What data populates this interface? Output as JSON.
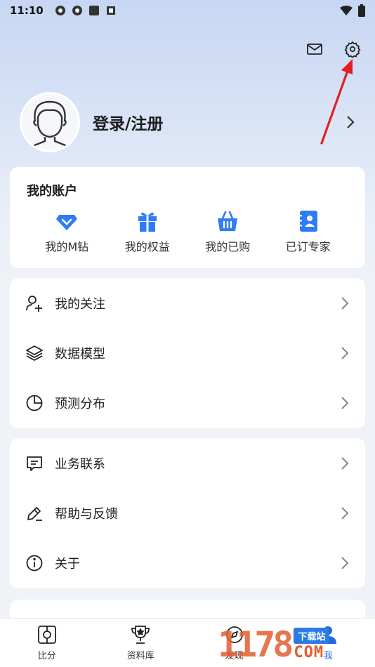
{
  "status_bar": {
    "time": "11:10"
  },
  "header": {
    "mail_icon": "mail-icon",
    "settings_icon": "gear-icon"
  },
  "profile": {
    "login_label": "登录/注册"
  },
  "account": {
    "title": "我的账户",
    "items": [
      {
        "label": "我的M钻",
        "icon": "diamond-icon",
        "color": "#2f7cf6"
      },
      {
        "label": "我的权益",
        "icon": "gift-icon",
        "color": "#2f7cf6"
      },
      {
        "label": "我的已购",
        "icon": "basket-icon",
        "color": "#2f7cf6"
      },
      {
        "label": "已订专家",
        "icon": "contact-book-icon",
        "color": "#2f7cf6"
      }
    ]
  },
  "menu_group1": [
    {
      "label": "我的关注",
      "icon": "user-plus-icon"
    },
    {
      "label": "数据模型",
      "icon": "layers-icon"
    },
    {
      "label": "预测分布",
      "icon": "pie-chart-icon"
    }
  ],
  "menu_group2": [
    {
      "label": "业务联系",
      "icon": "message-icon"
    },
    {
      "label": "帮助与反馈",
      "icon": "pen-icon"
    },
    {
      "label": "关于",
      "icon": "info-icon"
    }
  ],
  "bottom_nav": [
    {
      "label": "比分",
      "icon": "score-icon"
    },
    {
      "label": "资料库",
      "icon": "trophy-icon"
    },
    {
      "label": "发现",
      "icon": "discover-icon"
    },
    {
      "label": "我",
      "icon": "profile-icon"
    }
  ],
  "watermark": {
    "num": "1178",
    "tag": "下载站",
    "com": "COM"
  },
  "colors": {
    "accent": "#2f7cf6",
    "annotation": "#e02020"
  }
}
